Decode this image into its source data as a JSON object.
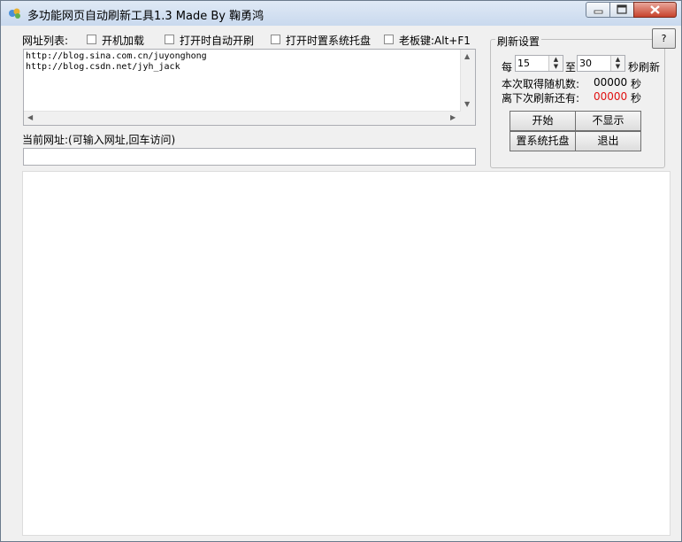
{
  "window": {
    "title": "多功能网页自动刷新工具1.3 Made By 鞠勇鸿"
  },
  "options": {
    "url_list_label": "网址列表:",
    "autostart_label": "开机加载",
    "auto_refresh_label": "打开时自动开刷",
    "tray_label": "打开时置系统托盘",
    "boss_key_label": "老板键:Alt+F1"
  },
  "url_list": {
    "text": "http://blog.sina.com.cn/juyonghong\nhttp://blog.csdn.net/jyh_jack"
  },
  "current_url": {
    "label": "当前网址:(可输入网址,回车访问)",
    "value": ""
  },
  "refresh_settings": {
    "group_title": "刷新设置",
    "help_label": "?",
    "every_label": "每",
    "min_value": "15",
    "to_label": "至",
    "max_value": "30",
    "seconds_refresh_label": "秒刷新",
    "random_label": "本次取得随机数:",
    "random_value": "00000",
    "random_unit": "秒",
    "next_label": "离下次刷新还有:",
    "next_value": "00000",
    "next_unit": "秒"
  },
  "buttons": {
    "start": "开始",
    "hide": "不显示",
    "tray": "置系统托盘",
    "exit": "退出"
  },
  "colors": {
    "countdown": "#e01010"
  }
}
